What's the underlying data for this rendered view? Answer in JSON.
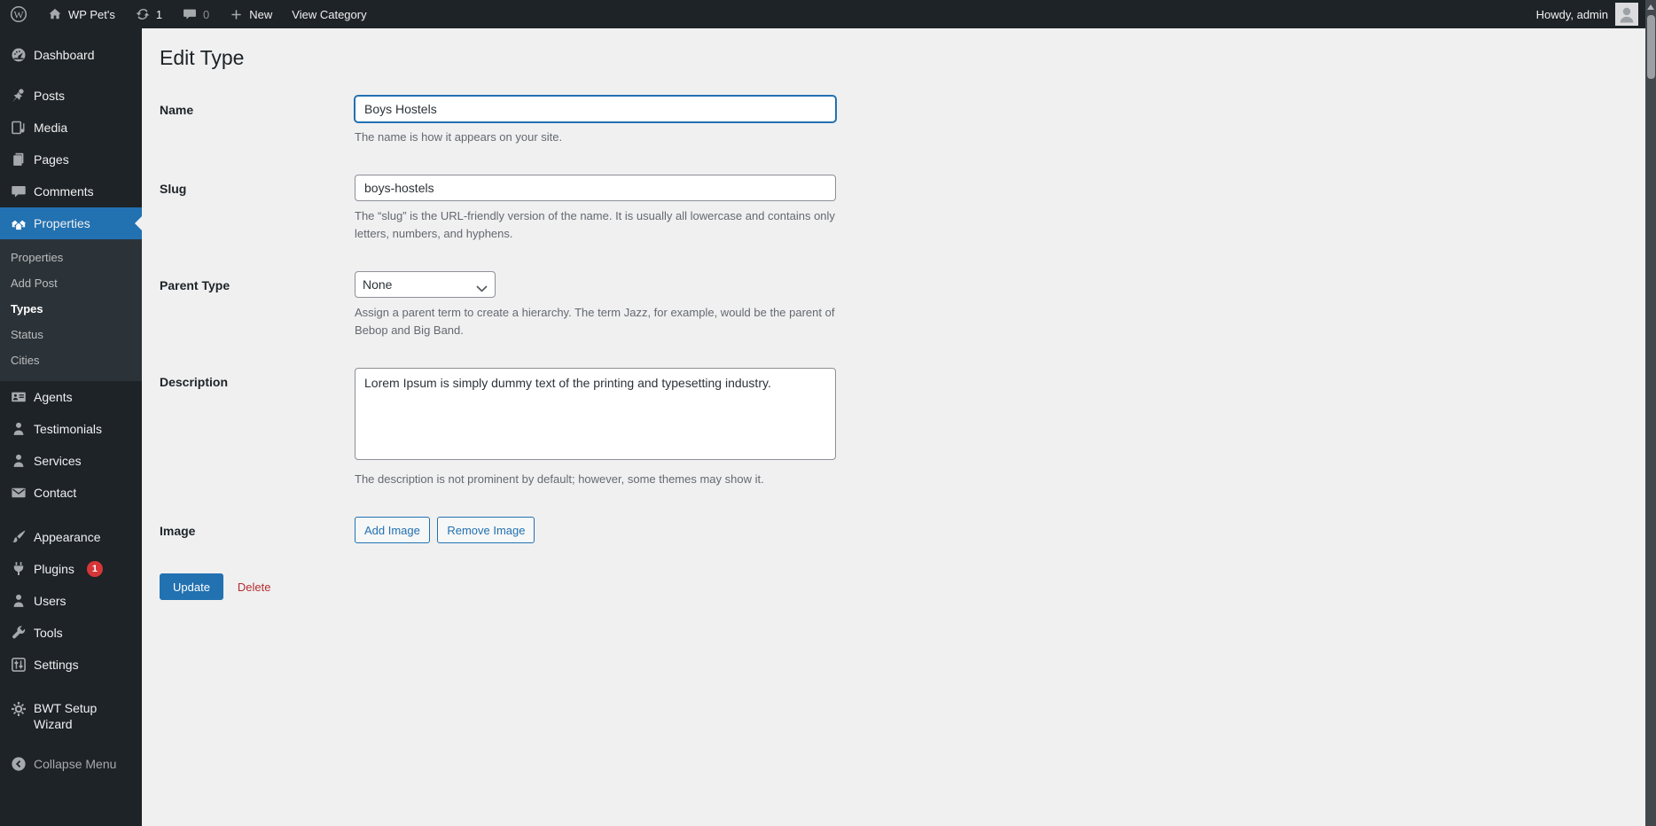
{
  "admin_bar": {
    "site_name": "WP Pet's",
    "update_count": "1",
    "comment_count": "0",
    "new_label": "New",
    "view_category_label": "View Category",
    "howdy_text": "Howdy, admin"
  },
  "sidebar": {
    "items": [
      {
        "label": "Dashboard",
        "icon": "dashboard-icon"
      },
      {
        "label": "Posts",
        "icon": "pushpin-icon"
      },
      {
        "label": "Media",
        "icon": "media-icon"
      },
      {
        "label": "Pages",
        "icon": "pages-icon"
      },
      {
        "label": "Comments",
        "icon": "comment-icon"
      },
      {
        "label": "Properties",
        "icon": "houses-icon",
        "active": true
      },
      {
        "label": "Agents",
        "icon": "id-card-icon"
      },
      {
        "label": "Testimonials",
        "icon": "person-icon"
      },
      {
        "label": "Services",
        "icon": "person-icon"
      },
      {
        "label": "Contact",
        "icon": "envelope-icon"
      },
      {
        "label": "Appearance",
        "icon": "paintbrush-icon"
      },
      {
        "label": "Plugins",
        "icon": "plug-icon",
        "badge": "1"
      },
      {
        "label": "Users",
        "icon": "person-icon"
      },
      {
        "label": "Tools",
        "icon": "wrench-icon"
      },
      {
        "label": "Settings",
        "icon": "sliders-icon"
      },
      {
        "label": "BWT Setup Wizard",
        "icon": "gear-icon"
      }
    ],
    "submenu": [
      {
        "label": "Properties"
      },
      {
        "label": "Add Post"
      },
      {
        "label": "Types",
        "current": true
      },
      {
        "label": "Status"
      },
      {
        "label": "Cities"
      }
    ],
    "collapse_label": "Collapse Menu"
  },
  "main": {
    "title": "Edit Type",
    "fields": {
      "name": {
        "label": "Name",
        "value": "Boys Hostels",
        "help": "The name is how it appears on your site."
      },
      "slug": {
        "label": "Slug",
        "value": "boys-hostels",
        "help": "The “slug” is the URL-friendly version of the name. It is usually all lowercase and contains only letters, numbers, and hyphens."
      },
      "parent": {
        "label": "Parent Type",
        "value": "None",
        "help": "Assign a parent term to create a hierarchy. The term Jazz, for example, would be the parent of Bebop and Big Band."
      },
      "description": {
        "label": "Description",
        "value": "Lorem Ipsum is simply dummy text of the printing and typesetting industry.",
        "help": "The description is not prominent by default; however, some themes may show it."
      },
      "image": {
        "label": "Image",
        "add_button": "Add Image",
        "remove_button": "Remove Image"
      }
    },
    "update_button": "Update",
    "delete_link": "Delete"
  },
  "colors": {
    "accent": "#2271b1",
    "admin_dark": "#1d2327",
    "badge_red": "#d63638",
    "delete_red": "#b32d2e",
    "content_bg": "#f0f0f1"
  }
}
